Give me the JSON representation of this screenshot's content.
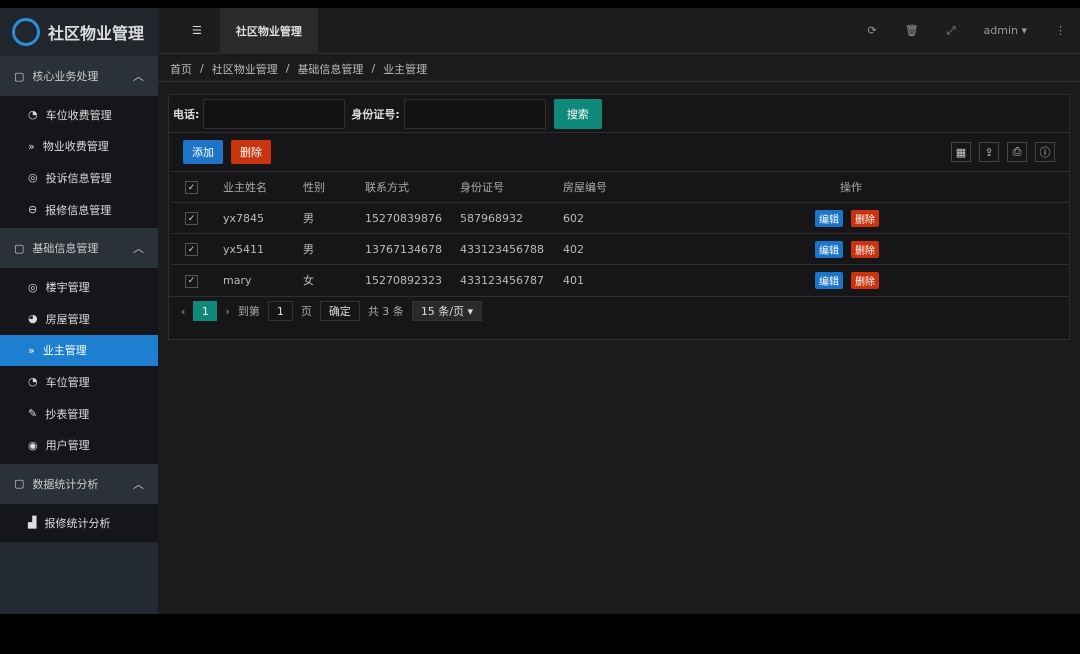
{
  "app": {
    "logo": "M",
    "title": "社区物业管理"
  },
  "header": {
    "tab": "社区物业管理",
    "user": "admin"
  },
  "sidebar": {
    "groups": [
      {
        "label": "核心业务处理",
        "items": [
          {
            "label": "车位收费管理",
            "icon": "dashboard-icon"
          },
          {
            "label": "物业收费管理",
            "icon": "chevron-double-down-icon"
          },
          {
            "label": "投诉信息管理",
            "icon": "target-icon"
          },
          {
            "label": "报修信息管理",
            "icon": "circle-minus-icon"
          }
        ]
      },
      {
        "label": "基础信息管理",
        "items": [
          {
            "label": "楼宇管理",
            "icon": "target-icon"
          },
          {
            "label": "房屋管理",
            "icon": "compass-icon"
          },
          {
            "label": "业主管理",
            "icon": "chevron-double-down-icon"
          },
          {
            "label": "车位管理",
            "icon": "dashboard-icon"
          },
          {
            "label": "抄表管理",
            "icon": "edit-icon"
          },
          {
            "label": "用户管理",
            "icon": "user-icon"
          }
        ]
      },
      {
        "label": "数据统计分析",
        "items": [
          {
            "label": "报修统计分析",
            "icon": "area-chart-icon"
          }
        ]
      }
    ]
  },
  "breadcrumb": [
    "首页",
    "社区物业管理",
    "基础信息管理",
    "业主管理"
  ],
  "search": {
    "phone_label": "电话:",
    "phone_value": "",
    "id_label": "身份证号:",
    "id_value": "",
    "button": "搜索"
  },
  "toolbar": {
    "add": "添加",
    "delete": "删除"
  },
  "table": {
    "headers": [
      "业主姓名",
      "性别",
      "联系方式",
      "身份证号",
      "房屋编号",
      "操作"
    ],
    "rows": [
      [
        "yx7845",
        "男",
        "15270839876",
        "587968932",
        "602"
      ],
      [
        "yx5411",
        "男",
        "13767134678",
        "433123456788",
        "402"
      ],
      [
        "mary",
        "女",
        "15270892323",
        "433123456787",
        "401"
      ]
    ],
    "edit": "编辑",
    "del": "删除"
  },
  "pager": {
    "current": "1",
    "goto": "到第",
    "page_value": "1",
    "page": "页",
    "confirm": "确定",
    "total": "共 3 条",
    "size": "15 条/页"
  }
}
